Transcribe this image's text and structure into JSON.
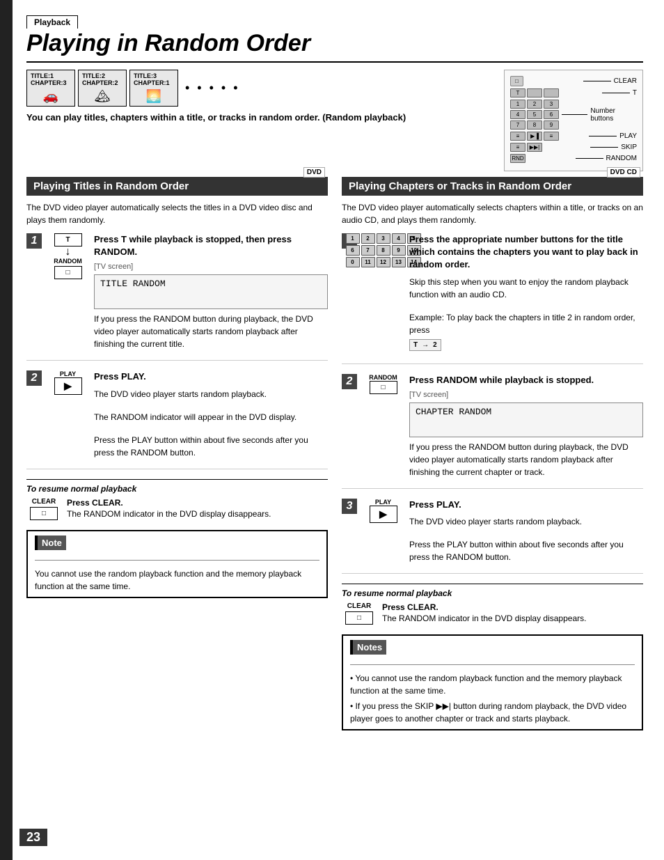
{
  "page": {
    "number": "23",
    "breadcrumb": "Playback",
    "title": "Playing in Random Order",
    "intro": "You can play titles, chapters within a title, or tracks in random order. (Random playback)"
  },
  "left_section": {
    "header": "Playing Titles in Random Order",
    "dvd_badge": "DVD",
    "description": "The DVD video player automatically selects the titles in a DVD video disc and plays them randomly.",
    "step1": {
      "number": "1",
      "icon_label": "T",
      "arrow": "↓",
      "random_label": "RANDOM",
      "title": "Press T while playback is stopped, then press RANDOM.",
      "tv_screen_label": "[TV screen]",
      "tv_screen_text": "TITLE RANDOM",
      "body": "If you press the RANDOM button during playback, the DVD video player automatically starts random playback after finishing the current title."
    },
    "step2": {
      "number": "2",
      "icon_label": "PLAY",
      "title": "Press PLAY.",
      "body1": "The DVD video player starts random playback.",
      "body2": "The RANDOM indicator will appear in the DVD display.",
      "body3": "Press the PLAY button within about five seconds after you press the RANDOM button."
    },
    "resume": {
      "title": "To resume normal playback",
      "clear_label": "CLEAR",
      "step_title": "Press CLEAR.",
      "step_body": "The RANDOM indicator in the DVD display disappears."
    },
    "note": {
      "title": "Note",
      "text": "You cannot use the random playback function and the memory playback function at the same time."
    }
  },
  "right_section": {
    "header": "Playing Chapters or Tracks in Random Order",
    "dvd_badge": "DVD  CD",
    "description": "The DVD video player automatically selects chapters within a title, or tracks on an audio CD, and plays them randomly.",
    "step1": {
      "number": "1",
      "title": "Press the appropriate number buttons for the title which contains the chapters you want to play back in random order.",
      "skip_text": "Skip this step when you want to enjoy the random playback function with an audio CD.",
      "example_text": "Example: To play back the chapters in title 2 in random order, press",
      "example_display": "T1→2"
    },
    "step2": {
      "number": "2",
      "random_label": "RANDOM",
      "title": "Press RANDOM while playback is stopped.",
      "tv_screen_label": "[TV screen]",
      "tv_screen_text": "CHAPTER RANDOM",
      "body": "If you press the RANDOM button during playback, the DVD video player automatically starts random playback after finishing the current chapter or track."
    },
    "step3": {
      "number": "3",
      "icon_label": "PLAY",
      "title": "Press PLAY.",
      "body1": "The DVD video player starts random playback.",
      "body2": "Press the PLAY button within about five seconds after you press the RANDOM button."
    },
    "resume": {
      "title": "To resume normal playback",
      "clear_label": "CLEAR",
      "step_title": "Press CLEAR.",
      "step_body": "The RANDOM indicator in the DVD display disappears."
    },
    "notes": {
      "title": "Notes",
      "note1": "You cannot use the random playback function and the memory playback function at the same time.",
      "note2": "If you press the SKIP ▶▶| button during random playback, the DVD video player goes to another chapter or track and starts playback."
    }
  },
  "remote": {
    "clear_label": "CLEAR",
    "t_label": "T",
    "number_buttons_label": "Number buttons",
    "play_label": "PLAY",
    "skip_label": "SKIP",
    "random_label": "RANDOM"
  }
}
